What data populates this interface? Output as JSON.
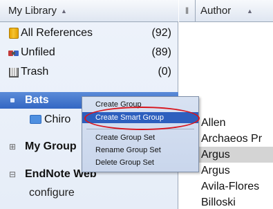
{
  "library_panel": {
    "header": "My Library",
    "items": [
      {
        "label": "All References",
        "count": "(92)"
      },
      {
        "label": "Unfiled",
        "count": "(89)"
      },
      {
        "label": "Trash",
        "count": "(0)"
      }
    ],
    "group_set_selected": "Bats",
    "subgroup": "Chiro",
    "group_sets": [
      {
        "label": "My Group"
      },
      {
        "label": "EndNote Web"
      }
    ],
    "footer_item": "configure"
  },
  "references_panel": {
    "column_title": "Author",
    "authors": [
      "Allen",
      "Archaeos Pr",
      "Argus",
      "Argus",
      "Avila-Flores",
      "Billoski"
    ],
    "highlighted_index": 2
  },
  "context_menu": {
    "items": [
      {
        "label": "Create Group"
      },
      {
        "label": "Create Smart Group"
      },
      {
        "label": "Create Group Set"
      },
      {
        "label": "Rename Group Set"
      },
      {
        "label": "Delete Group Set"
      }
    ],
    "active_index": 1
  },
  "colors": {
    "selection": "#3467c3",
    "annotation_ellipse": "#d8141c",
    "menu_highlight": "#2d5fbe"
  }
}
